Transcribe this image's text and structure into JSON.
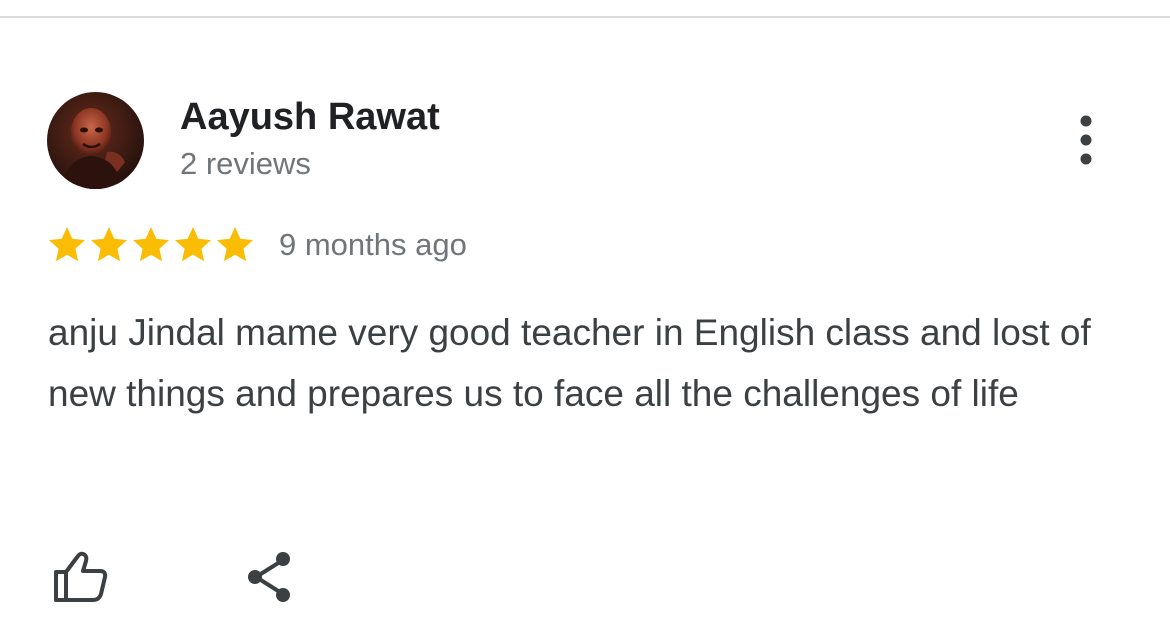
{
  "review": {
    "author": {
      "name": "Aayush Rawat",
      "meta": "2 reviews",
      "avatar_icon": "profile-photo"
    },
    "rating": {
      "value": 5,
      "max": 5,
      "star_color": "#fbbc04"
    },
    "time_ago": "9 months ago",
    "text": "anju Jindal mame very good teacher in English class and lost of new things and prepares us to face all the challenges of life",
    "actions": {
      "like_icon": "thumbs-up-icon",
      "share_icon": "share-icon"
    },
    "menu_icon": "more-vert-icon"
  },
  "colors": {
    "name_text": "#202124",
    "secondary_text": "#70757a",
    "body_text": "#3c4043",
    "icon": "#3c4043",
    "divider": "#dadce0"
  }
}
